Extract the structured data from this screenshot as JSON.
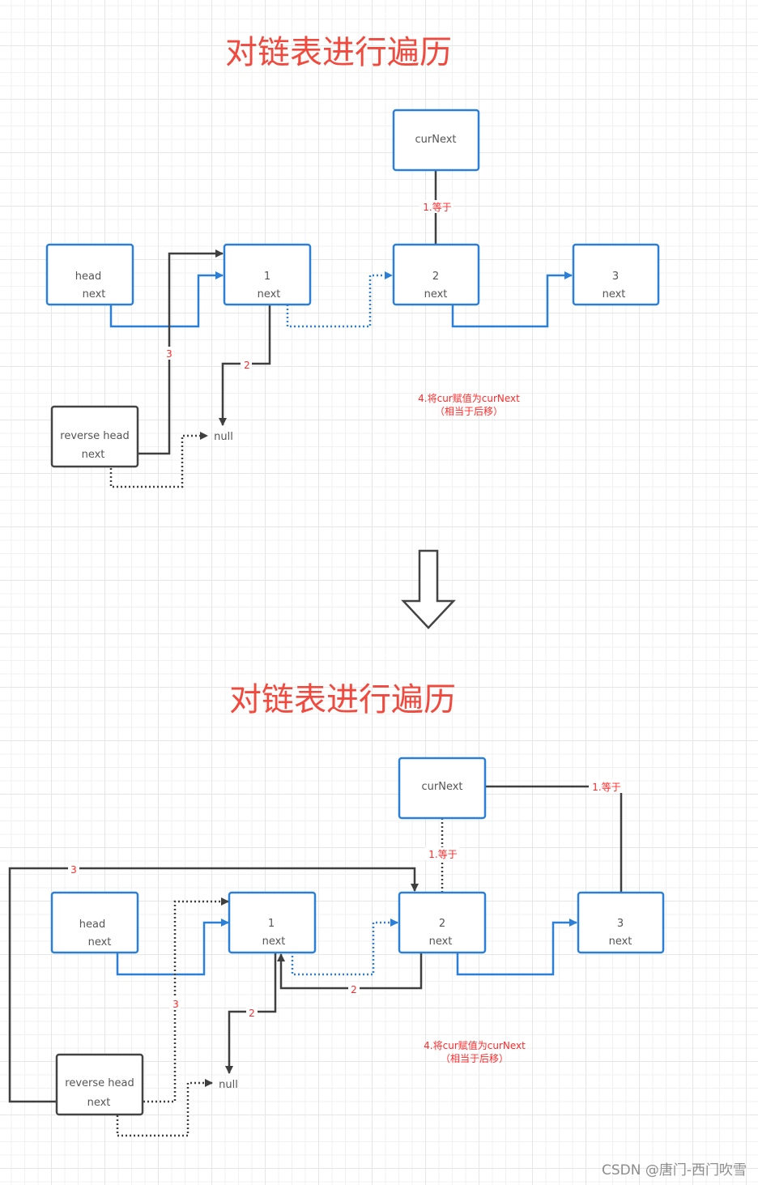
{
  "colors": {
    "title": "#f04a3e",
    "node_border_blue": "#2b7fd6",
    "node_border_dark": "#444444",
    "edge_blue": "#2b7fd6",
    "edge_dark": "#3f3f3f",
    "label_red": "#ff2a2a",
    "grid": "#e6e6e6"
  },
  "diagram_top": {
    "title": "对链表进行遍历",
    "nodes": {
      "curNext": {
        "line1": "curNext"
      },
      "head": {
        "line1": "head",
        "line2": "next"
      },
      "n1": {
        "line1": "1",
        "line2": "next"
      },
      "n2": {
        "line1": "2",
        "line2": "next"
      },
      "n3": {
        "line1": "3",
        "line2": "next"
      },
      "reverse": {
        "line1": "reverse head",
        "line2": "next"
      },
      "null": {
        "text": "null"
      }
    },
    "edge_labels": {
      "curnext_eq": "1.等于",
      "step2": "2",
      "step3": "3"
    },
    "note": {
      "line1": "4.将cur赋值为curNext",
      "line2": "（相当于后移）"
    }
  },
  "transition_arrow": {
    "icon": "down-arrow-icon"
  },
  "diagram_bottom": {
    "title": "对链表进行遍历",
    "nodes": {
      "curNext": {
        "line1": "curNext"
      },
      "head": {
        "line1": "head",
        "line2": "next"
      },
      "n1": {
        "line1": "1",
        "line2": "next"
      },
      "n2": {
        "line1": "2",
        "line2": "next"
      },
      "n3": {
        "line1": "3",
        "line2": "next"
      },
      "reverse": {
        "line1": "reverse head",
        "line2": "next"
      },
      "null": {
        "text": "null"
      }
    },
    "edge_labels": {
      "curnext_eq_n3": "1.等于",
      "curnext_eq_n2": "1.等于",
      "step3_outer": "3",
      "step3_dotted": "3",
      "step2_n2_to_n1": "2",
      "step2_n1_to_null": "2"
    },
    "note": {
      "line1": "4.将cur赋值为curNext",
      "line2": "（相当于后移）"
    }
  },
  "watermark": "CSDN @唐门-西门吹雪"
}
